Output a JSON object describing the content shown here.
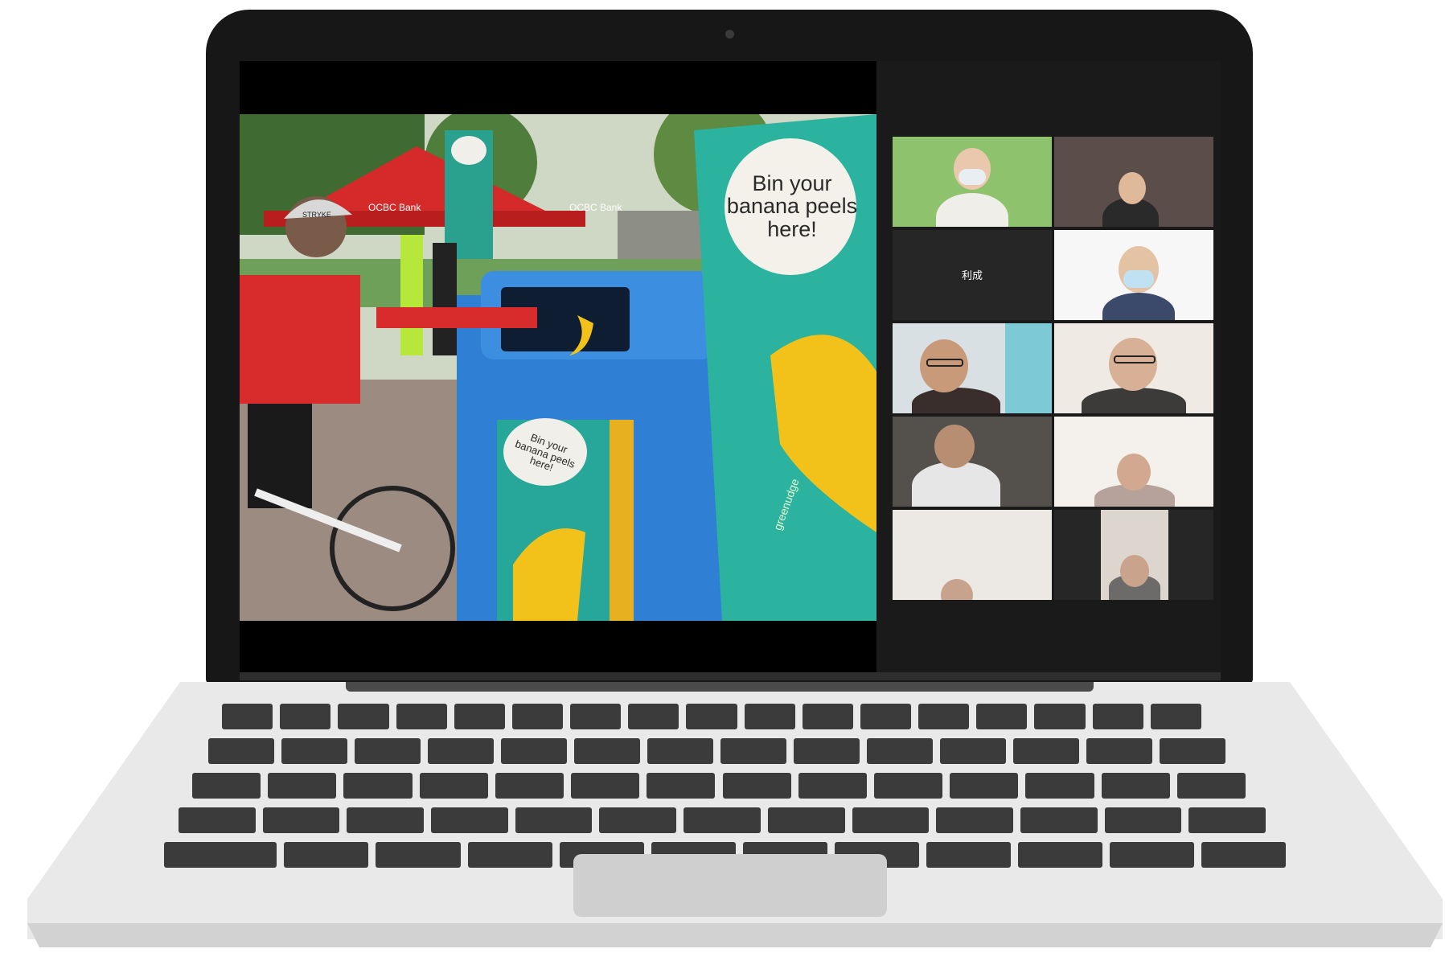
{
  "screen_share": {
    "signs": {
      "main_sign": [
        "Bin your",
        "banana peels",
        "here!"
      ],
      "bin_sign": [
        "Bin your",
        "banana peels",
        "here!"
      ]
    },
    "tent_banner": "OCBC Bank",
    "helmet_label": "STRYKE",
    "sign_brand": "greenudge"
  },
  "gallery": {
    "participants": [
      {
        "name": "",
        "kind": "video"
      },
      {
        "name": "",
        "kind": "video"
      },
      {
        "name": "利成",
        "kind": "name-only"
      },
      {
        "name": "",
        "kind": "video"
      },
      {
        "name": "",
        "kind": "video"
      },
      {
        "name": "",
        "kind": "video"
      },
      {
        "name": "",
        "kind": "video"
      },
      {
        "name": "",
        "kind": "video"
      },
      {
        "name": "",
        "kind": "video"
      },
      {
        "name": "",
        "kind": "video"
      }
    ]
  },
  "colors": {
    "bezel": "#171717",
    "bin_blue": "#2f7fd4",
    "tent_red": "#d42a2a",
    "sign_teal": "#27a79a",
    "banana_yellow": "#f2c21b",
    "laptop_silver": "#e9e9e9"
  },
  "icons": {
    "camera": "webcam-dot"
  }
}
